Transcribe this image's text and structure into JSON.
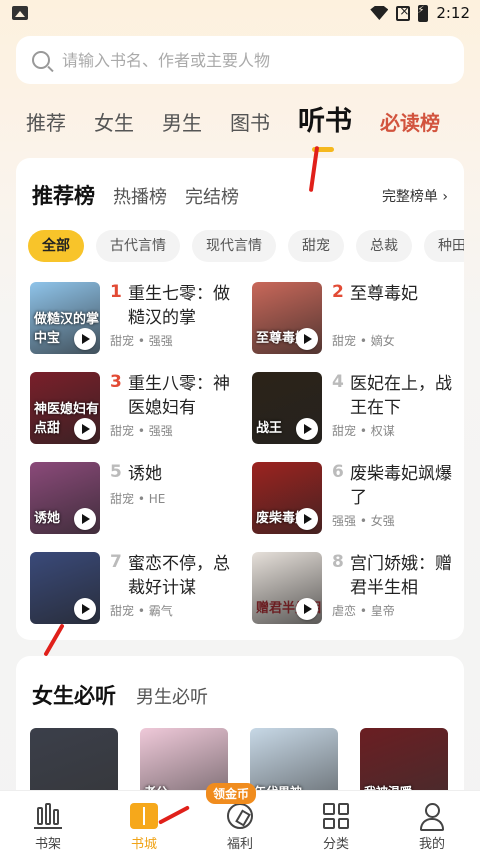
{
  "status_bar": {
    "time": "2:12",
    "icons": [
      "gallery-icon",
      "wifi-icon",
      "no-sim-icon",
      "battery-charging-icon"
    ]
  },
  "search": {
    "placeholder": "请输入书名、作者或主要人物"
  },
  "top_tabs": [
    "推荐",
    "女生",
    "男生",
    "图书",
    "听书",
    "必读榜"
  ],
  "active_top_tab": "听书",
  "ranking": {
    "tabs": [
      "推荐榜",
      "热播榜",
      "完结榜"
    ],
    "full_list_label": "完整榜单 ›",
    "filters": [
      "全部",
      "古代言情",
      "现代言情",
      "甜宠",
      "总裁",
      "种田"
    ],
    "books": [
      {
        "rank": "1",
        "title": "重生七零：做糙汉的掌",
        "tags": "甜宠 • 强强",
        "cover_text": "做糙汉的掌中宝",
        "cover_color": "#8fc4ea"
      },
      {
        "rank": "2",
        "title": "至尊毒妃",
        "tags": "甜宠 • 嫡女",
        "cover_text": "至尊毒妃",
        "cover_color": "#c9685a"
      },
      {
        "rank": "3",
        "title": "重生八零：神医媳妇有",
        "tags": "甜宠 • 强强",
        "cover_text": "神医媳妇有点甜",
        "cover_color": "#7a1f2a"
      },
      {
        "rank": "4",
        "title": "医妃在上，战王在下",
        "tags": "甜宠 • 权谋",
        "cover_text": "战王",
        "cover_color": "#2c2318"
      },
      {
        "rank": "5",
        "title": "诱她",
        "tags": "甜宠 • HE",
        "cover_text": "诱她",
        "cover_color": "#8b4a7a"
      },
      {
        "rank": "6",
        "title": "废柴毒妃飒爆了",
        "tags": "强强 • 女强",
        "cover_text": "废柴毒妃",
        "cover_color": "#9c2320"
      },
      {
        "rank": "7",
        "title": "蜜恋不停，总裁好计谋",
        "tags": "甜宠 • 霸气",
        "cover_text": "",
        "cover_color": "#3a4a7a"
      },
      {
        "rank": "8",
        "title": "宫门娇娥：赠君半生相",
        "tags": "虐恋 • 皇帝",
        "cover_text": "赠君半生相",
        "cover_color": "#e6e0da"
      }
    ]
  },
  "must_read": {
    "tabs": [
      "女生必听",
      "男生必听"
    ],
    "covers": [
      {
        "cover_text": "",
        "cover_color": "#3b3f4a"
      },
      {
        "cover_text": "老公",
        "cover_color": "#efc9d9"
      },
      {
        "cover_text": "年代男神",
        "cover_color": "#c7d8e6"
      },
      {
        "cover_text": "我被温暖",
        "cover_color": "#6b1e22"
      }
    ]
  },
  "bottom_nav": [
    {
      "label": "书架",
      "icon": "bookshelf-icon"
    },
    {
      "label": "书城",
      "icon": "bookstore-icon",
      "active": true
    },
    {
      "label": "福利",
      "icon": "welfare-icon",
      "badge": "领金币"
    },
    {
      "label": "分类",
      "icon": "category-icon"
    },
    {
      "label": "我的",
      "icon": "profile-icon"
    }
  ],
  "colors": {
    "accent": "#f8c42a",
    "rank_top3": "#e24b35",
    "rank_other": "#bbbbbb",
    "nav_active": "#f0a317",
    "annotation_arrow": "#e0201a"
  }
}
